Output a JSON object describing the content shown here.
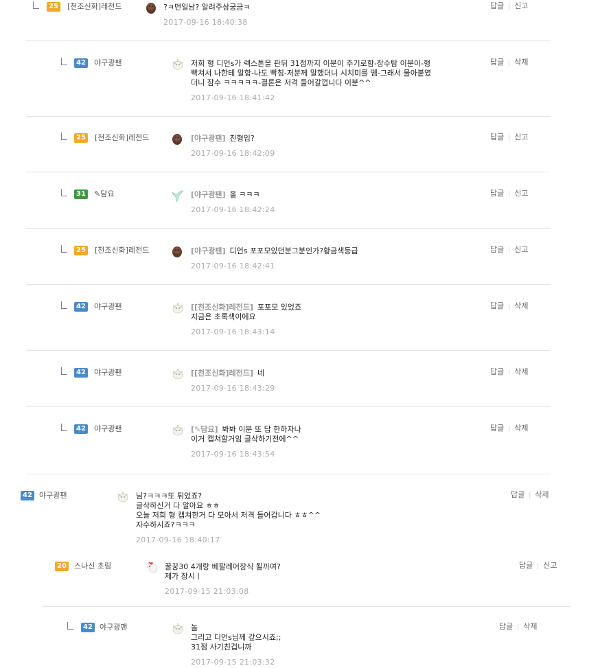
{
  "comments": [
    {
      "lvl": "25",
      "lvl_color": "#f0a92a",
      "nick": "[천조신화]레전드",
      "avatar": "dark",
      "mention": "",
      "text": "?ㅋ먼일남? 알려주삼궁금ㅋ",
      "time": "2017-09-16 18:40:38",
      "a1": "답글",
      "a2": "신고"
    },
    {
      "lvl": "42",
      "lvl_color": "#4a8ac9",
      "nick": "야구광팬",
      "avatar": "light",
      "mention": "",
      "text": "저희 형 디언s가 렉스톤을 판뒤 31점까지 이분이 주기로함-장수탐 이분이-형\n빡쳐서 나한테 말함-나도 빡침-저분께 말했더니 시치미를 뗌-그래서 물아붙였\n더니 잠수 ㅋㅋㅋㅋㅋ-결론은 저격 들어갈껍니다 이분^^",
      "time": "2017-09-16 18:41:42",
      "a1": "답글",
      "a2": "삭제"
    },
    {
      "lvl": "25",
      "lvl_color": "#f0a92a",
      "nick": "[천조신화]레전드",
      "avatar": "dark",
      "mention": "[야구광팬]",
      "text": "친형임?",
      "time": "2017-09-16 18:42:09",
      "a1": "답글",
      "a2": "신고"
    },
    {
      "lvl": "31",
      "lvl_color": "#3f9a3f",
      "nick": "✎담요",
      "avatar": "bird",
      "mention": "[야구광팬]",
      "text": "올 ㅋㅋㅋ",
      "time": "2017-09-16 18:42:24",
      "a1": "답글",
      "a2": "신고"
    },
    {
      "lvl": "25",
      "lvl_color": "#f0a92a",
      "nick": "[천조신화]레전드",
      "avatar": "dark",
      "mention": "[야구광팬]",
      "text": "디언s 포포모있던분그분인가?황금색등급",
      "time": "2017-09-16 18:42:41",
      "a1": "답글",
      "a2": "신고"
    },
    {
      "lvl": "42",
      "lvl_color": "#4a8ac9",
      "nick": "야구광팬",
      "avatar": "light",
      "mention": "[[천조신화]레전드]",
      "text": "포포모 있었죠\n지금은 초록색이에요",
      "time": "2017-09-16 18:43:14",
      "a1": "답글",
      "a2": "삭제"
    },
    {
      "lvl": "42",
      "lvl_color": "#4a8ac9",
      "nick": "야구광팬",
      "avatar": "light",
      "mention": "[[천조신화]레전드]",
      "text": "네",
      "time": "2017-09-16 18:43:29",
      "a1": "답글",
      "a2": "삭제"
    },
    {
      "lvl": "42",
      "lvl_color": "#4a8ac9",
      "nick": "야구광팬",
      "avatar": "light",
      "mention": "[✎담요]",
      "text": "봐봐 이분 또 답 한하자나\n이거 캡쳐할거임 글삭하기전에^^",
      "time": "2017-09-16 18:43:54",
      "a1": "답글",
      "a2": "삭제"
    },
    {
      "lvl": "42",
      "lvl_color": "#4a8ac9",
      "nick": "야구광팬",
      "avatar": "light",
      "mention": "",
      "text": "님?ㅋㅋㅋ또 튀었죠?\n글삭하신거 다 알아요 ㅎㅎ\n오늘 저희 형 캡쳐한거 다 모아서 저격 들어갑니다 ㅎㅎ^^\n자수하시죠?ㅋㅋㅋ",
      "time": "2017-09-16 18:40:17",
      "a1": "답글",
      "a2": "삭제"
    },
    {
      "lvl": "20",
      "lvl_color": "#f0a92a",
      "nick": "스나신 초림",
      "avatar": "rooster",
      "mention": "",
      "text": "꿀꿍30 4개랑 베팔레어장식 될까여?\n제가 장시ㅣ",
      "time": "2017-09-15 21:03:08",
      "a1": "답글",
      "a2": "신고"
    },
    {
      "lvl": "42",
      "lvl_color": "#4a8ac9",
      "nick": "야구광팬",
      "avatar": "light",
      "mention": "",
      "text": "놀\n그리고 디언s님께 갚으시죠;;\n31점 사기친겁니까",
      "time": "2017-09-15 21:03:32",
      "a1": "답글",
      "a2": "삭제"
    }
  ]
}
